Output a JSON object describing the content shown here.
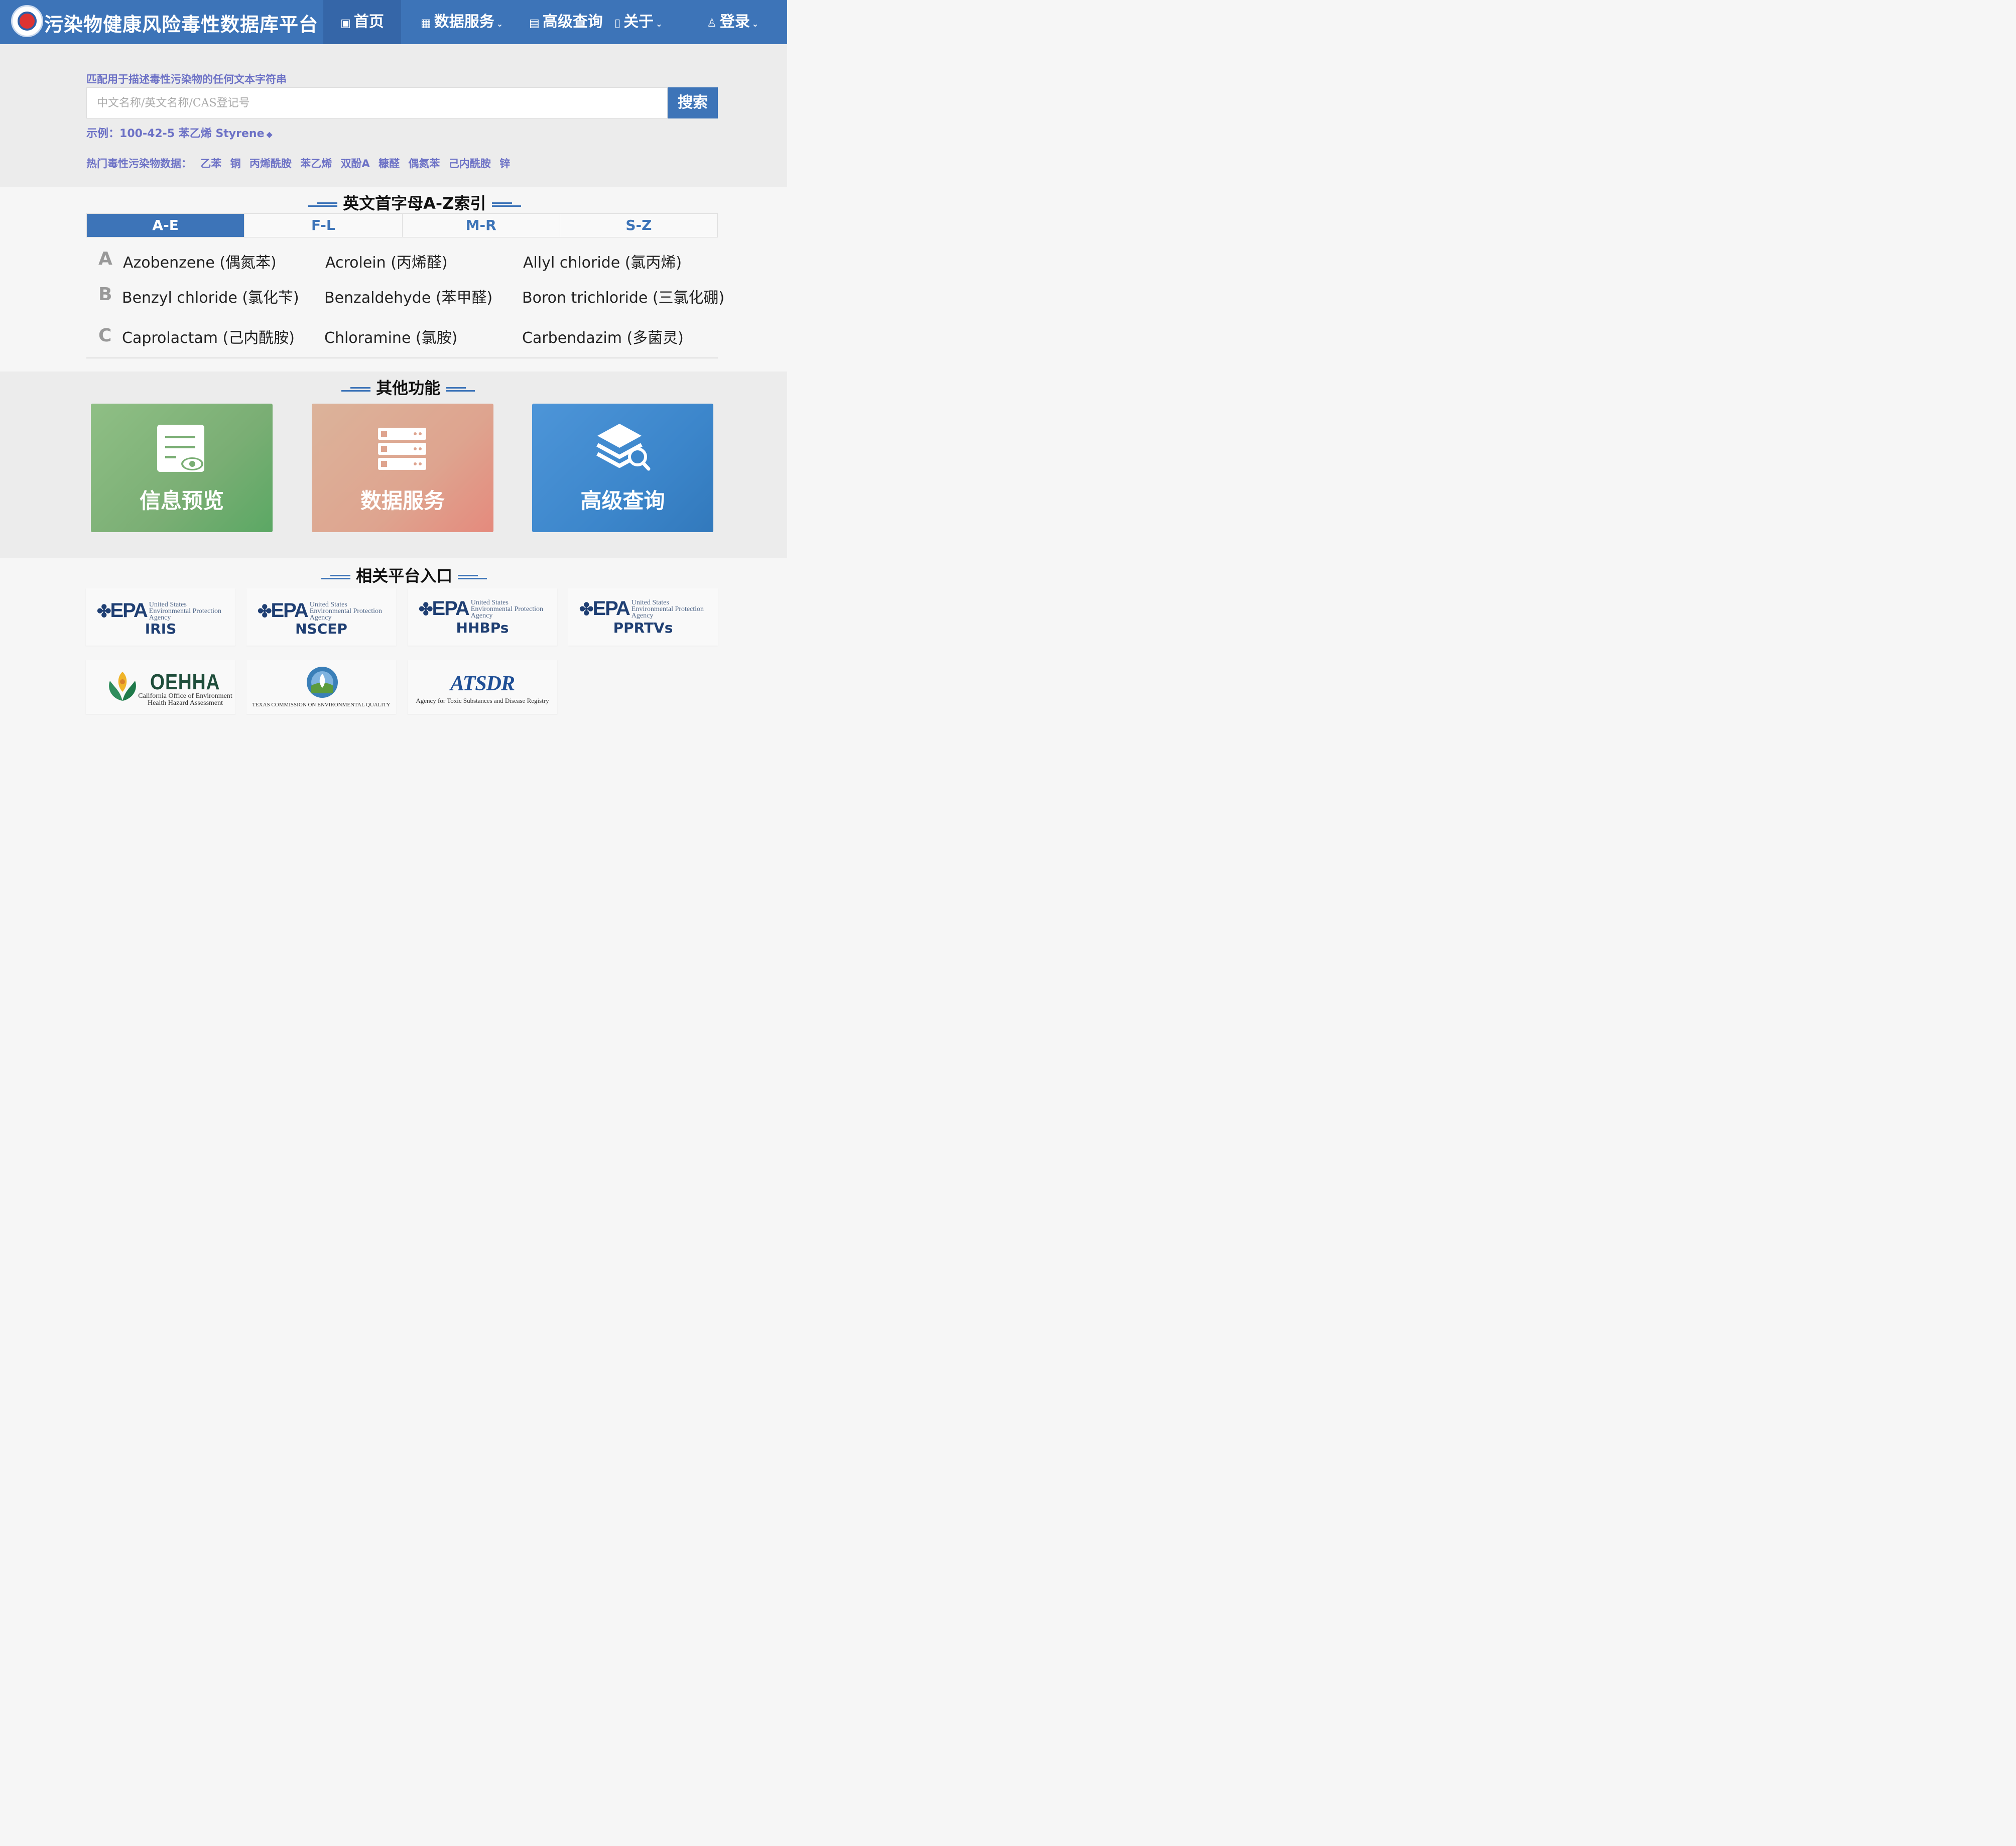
{
  "nav": {
    "site_title": "污染物健康风险毒性数据库平台",
    "home": "首页",
    "data_service": "数据服务",
    "advanced_query": "高级查询",
    "about": "关于",
    "login": "登录"
  },
  "search": {
    "hint": "匹配用于描述毒性污染物的任何文本字符串",
    "placeholder": "中文名称/英文名称/CAS登记号",
    "button": "搜索",
    "example_label": "示例：",
    "example_value": "100-42-5 苯乙烯 Styrene",
    "hot_label": "热门毒性污染物数据：",
    "hot_items": [
      "乙苯",
      "铜",
      "丙烯酰胺",
      "苯乙烯",
      "双酚A",
      "糠醛",
      "偶氮苯",
      "己内酰胺",
      "锌"
    ]
  },
  "az_index": {
    "title": "英文首字母A-Z索引",
    "tabs": [
      "A-E",
      "F-L",
      "M-R",
      "S-Z"
    ],
    "active_tab": "A-E",
    "rows": [
      {
        "letter": "A",
        "items": [
          "Azobenzene (偶氮苯)",
          "Acrolein (丙烯醛)",
          "Allyl chloride (氯丙烯)"
        ]
      },
      {
        "letter": "B",
        "items": [
          "Benzyl chloride (氯化苄)",
          "Benzaldehyde (苯甲醛)",
          "Boron trichloride (三氯化硼)"
        ]
      },
      {
        "letter": "C",
        "items": [
          "Caprolactam (己内酰胺)",
          "Chloramine (氯胺)",
          "Carbendazim (多菌灵)"
        ]
      }
    ]
  },
  "other_functions": {
    "title": "其他功能",
    "cards": [
      "信息预览",
      "数据服务",
      "高级查询"
    ]
  },
  "related": {
    "title": "相关平台入口",
    "epa_logo": "EPA",
    "epa_sub": [
      "United States",
      "Environmental Protection",
      "Agency"
    ],
    "epa_entries": [
      "IRIS",
      "NSCEP",
      "HHBPs",
      "PPRTVs"
    ],
    "oehha": {
      "name": "OEHHA",
      "sub1": "California Office of Environment",
      "sub2": "Health Hazard Assessment"
    },
    "tceq": "TEXAS COMMISSION ON ENVIRONMENTAL QUALITY",
    "atsdr": {
      "name": "ATSDR",
      "sub": "Agency for Toxic Substances and Disease Registry"
    }
  },
  "colors": {
    "primary": "#3d74b8",
    "link": "#6d72c6",
    "green": "#7aae74",
    "orange": "#dea48f",
    "blue": "#3c86cb"
  }
}
